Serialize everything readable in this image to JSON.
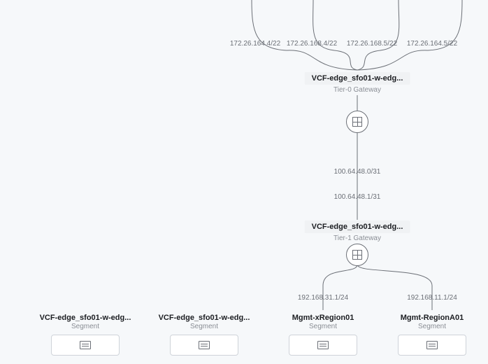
{
  "uplinks": [
    {
      "ip": "172.26.164.4/22"
    },
    {
      "ip": "172.26.168.4/22"
    },
    {
      "ip": "172.26.168.5/22"
    },
    {
      "ip": "172.26.164.5/22"
    }
  ],
  "tier0": {
    "title": "VCF-edge_sfo01-w-edg...",
    "subtitle": "Tier-0 Gateway"
  },
  "tier0_tier1_link": {
    "top_ip": "100.64.48.0/31",
    "bottom_ip": "100.64.48.1/31"
  },
  "tier1": {
    "title": "VCF-edge_sfo01-w-edg...",
    "subtitle": "Tier-1 Gateway"
  },
  "tier1_segments": [
    {
      "ip": "192.168.31.1/24",
      "title": "Mgmt-xRegion01",
      "subtitle": "Segment"
    },
    {
      "ip": "192.168.11.1/24",
      "title": "Mgmt-RegionA01",
      "subtitle": "Segment"
    }
  ],
  "detached_segments": [
    {
      "title": "VCF-edge_sfo01-w-edg...",
      "subtitle": "Segment"
    },
    {
      "title": "VCF-edge_sfo01-w-edg...",
      "subtitle": "Segment"
    }
  ]
}
